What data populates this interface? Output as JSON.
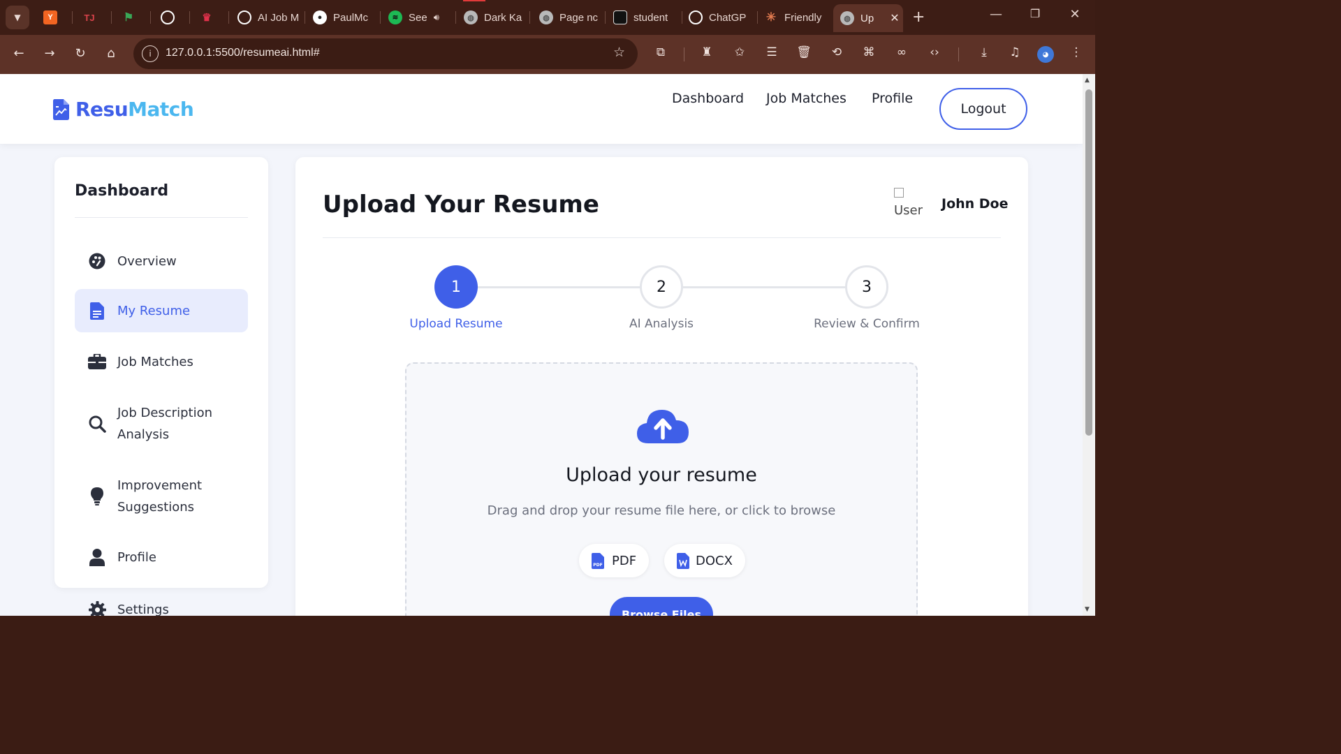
{
  "browser": {
    "tabs": [
      {
        "label": "",
        "icon": "y-combinator-icon",
        "color": "#f26522"
      },
      {
        "label": "",
        "icon": "tj-icon",
        "color": "#d9434b"
      },
      {
        "label": "",
        "icon": "flag-icon",
        "color": "#3aa757"
      },
      {
        "label": "",
        "icon": "openai-icon",
        "color": "#ffffff"
      },
      {
        "label": "",
        "icon": "crown-icon",
        "color": "#e0314b"
      },
      {
        "label": "AI Job M",
        "icon": "openai-icon",
        "color": "#ffffff"
      },
      {
        "label": "PaulMc",
        "icon": "github-icon",
        "color": "#ffffff"
      },
      {
        "label": "See",
        "icon": "spotify-icon",
        "color": "#1db954"
      },
      {
        "label": "Dark Ka",
        "icon": "globe-icon",
        "color": "#cccccc"
      },
      {
        "label": "Page nc",
        "icon": "globe-icon",
        "color": "#cccccc"
      },
      {
        "label": "student",
        "icon": "site-icon",
        "color": "#111111"
      },
      {
        "label": "ChatGP",
        "icon": "openai-icon",
        "color": "#ffffff"
      },
      {
        "label": "Friendly",
        "icon": "claude-icon",
        "color": "#e07a4f"
      }
    ],
    "active_tab": "Up",
    "url": "127.0.0.1:5500/resumeai.html#"
  },
  "header": {
    "logo_part1": "Resu",
    "logo_part2": "Match",
    "nav": [
      "Dashboard",
      "Job Matches",
      "Profile"
    ],
    "logout": "Logout"
  },
  "sidebar": {
    "title": "Dashboard",
    "items": [
      {
        "label": "Overview",
        "icon": "palette-icon"
      },
      {
        "label": "My Resume",
        "icon": "document-icon",
        "active": true
      },
      {
        "label": "Job Matches",
        "icon": "briefcase-icon"
      },
      {
        "label": "Job Description Analysis",
        "icon": "search-icon"
      },
      {
        "label": "Improvement Suggestions",
        "icon": "lightbulb-icon"
      },
      {
        "label": "Profile",
        "icon": "user-icon"
      },
      {
        "label": "Settings",
        "icon": "gear-icon"
      }
    ]
  },
  "main": {
    "title": "Upload Your Resume",
    "user_alt": "User",
    "user_name": "John Doe",
    "steps": [
      {
        "number": "1",
        "label": "Upload Resume"
      },
      {
        "number": "2",
        "label": "AI Analysis"
      },
      {
        "number": "3",
        "label": "Review & Confirm"
      }
    ],
    "upload": {
      "title": "Upload your resume",
      "subtitle": "Drag and drop your resume file here, or click to browse",
      "formats": [
        "PDF",
        "DOCX"
      ],
      "browse": "Browse Files"
    }
  },
  "colors": {
    "primary": "#3f5fe8",
    "accent": "#4bb7ef",
    "active_bg": "#e8ecfd"
  }
}
